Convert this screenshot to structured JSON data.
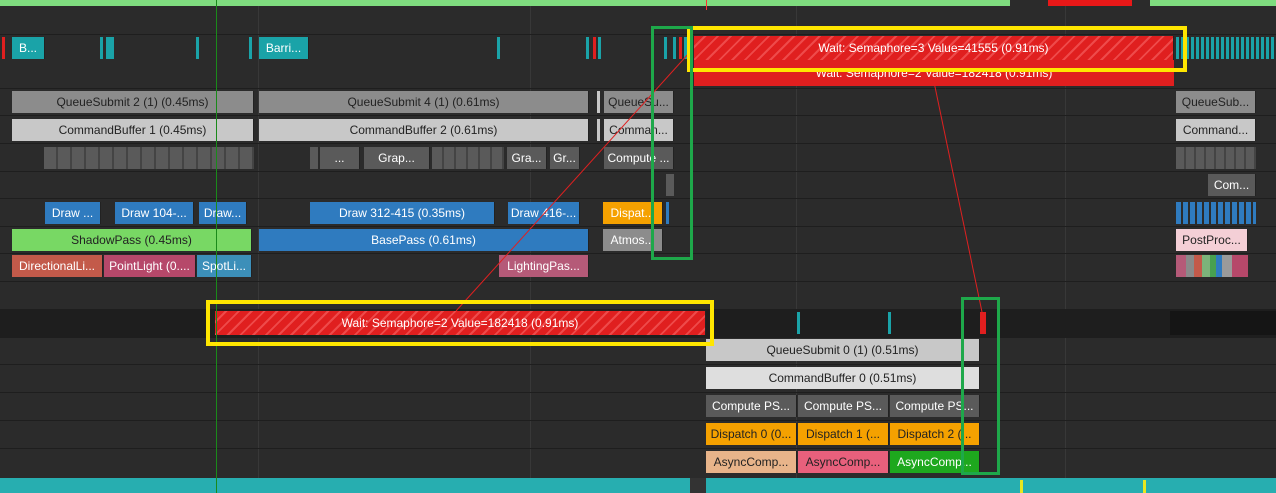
{
  "colors": {
    "background": "#2b2b2b",
    "wait": "#e01f1f",
    "queue_submit": "#8c8c8c",
    "command_buffer": "#c8c8c8",
    "draw": "#2f7bbf",
    "shadow_pass": "#78d864",
    "base_pass": "#2f7bbf",
    "dispatch": "#f5a100",
    "highlight_yellow": "#ffe600",
    "highlight_green": "#1ea84a",
    "barrier": "#1aa3a8"
  },
  "graphics_queue": {
    "barrier_left": "B...",
    "barrier_right": "Barri...",
    "wait_top": "Wait: Semaphore=3 Value=41555 (0.91ms)",
    "wait_top_under": "Wait: Semaphore=2 Value=182418 (0.91ms)",
    "queue_submits": [
      "QueueSubmit 2 (1) (0.45ms)",
      "QueueSubmit 4 (1) (0.61ms)",
      "QueueSu...",
      "QueueSub..."
    ],
    "command_buffers": [
      "CommandBuffer 1 (0.45ms)",
      "CommandBuffer 2 (0.61ms)",
      "Comman...",
      "Command..."
    ],
    "groups": [
      "...",
      "Grap...",
      "Gra...",
      "Gr...",
      "Compute ...",
      "Com..."
    ],
    "draws": [
      "Draw ...",
      "Draw 104-...",
      "Draw...",
      "Draw 312-415 (0.35ms)",
      "Draw 416-...",
      "Dispat..."
    ],
    "passes": [
      "ShadowPass (0.45ms)",
      "BasePass (0.61ms)",
      "Atmos...",
      "PostProc..."
    ],
    "sub_passes": [
      "DirectionalLi...",
      "PointLight (0....",
      "SpotLi...",
      "LightingPas..."
    ]
  },
  "async_queue": {
    "wait": "Wait: Semaphore=2 Value=182418 (0.91ms)",
    "queue_submit": "QueueSubmit 0 (1) (0.51ms)",
    "command_buffer": "CommandBuffer 0 (0.51ms)",
    "compute": [
      "Compute PS...",
      "Compute PS...",
      "Compute PS..."
    ],
    "dispatch": [
      "Dispatch 0 (0...",
      "Dispatch 1 (...",
      "Dispatch 2 (..."
    ],
    "async_compute": [
      "AsyncComp...",
      "AsyncComp...",
      "AsyncComp..."
    ]
  }
}
